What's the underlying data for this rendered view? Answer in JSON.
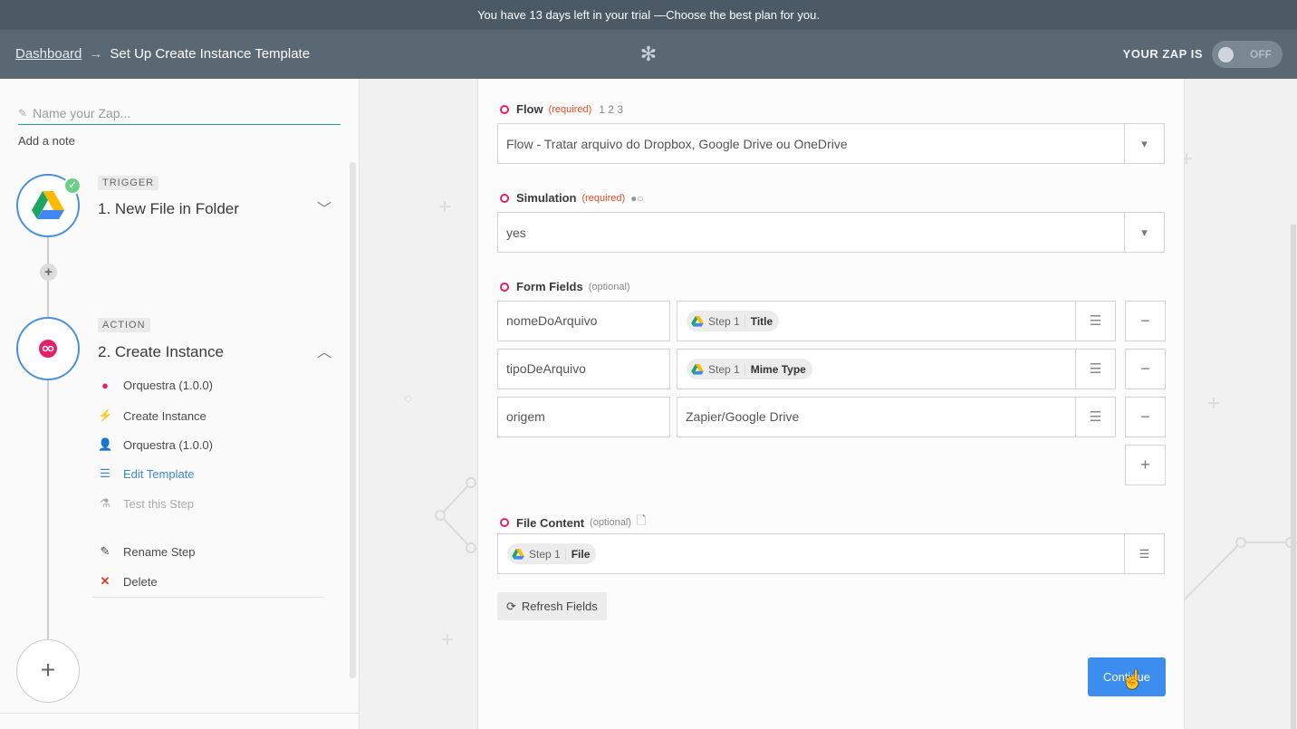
{
  "trial": {
    "lead": "You have 13 days left in your trial",
    "cta": "—Choose the best plan for you."
  },
  "header": {
    "dashboard": "Dashboard",
    "arrow": "→",
    "title": "Set Up Create Instance Template",
    "zap_label": "YOUR ZAP IS",
    "zap_state": "OFF"
  },
  "sidebar": {
    "name_placeholder": "Name your Zap...",
    "add_note": "Add a note",
    "trigger": {
      "badge": "TRIGGER",
      "title": "1. New File in Folder"
    },
    "action": {
      "badge": "ACTION",
      "title": "2. Create Instance"
    },
    "substeps": [
      {
        "label": "Orquestra (1.0.0)",
        "icon": "orquestra-icon"
      },
      {
        "label": "Create Instance",
        "icon": "bolt-icon"
      },
      {
        "label": "Orquestra (1.0.0)",
        "icon": "user-icon"
      },
      {
        "label": "Edit Template",
        "icon": "list-icon"
      },
      {
        "label": "Test this Step",
        "icon": "flask-icon"
      }
    ],
    "rename": "Rename Step",
    "delete": "Delete"
  },
  "form": {
    "flow": {
      "label": "Flow",
      "required": "(required)",
      "extra": "1 2 3",
      "value": "Flow - Tratar arquivo do Dropbox, Google Drive ou OneDrive"
    },
    "simulation": {
      "label": "Simulation",
      "required": "(required)",
      "value": "yes"
    },
    "form_fields": {
      "label": "Form Fields",
      "optional": "(optional)",
      "rows": [
        {
          "key": "nomeDoArquivo",
          "step": "Step 1",
          "field": "Title"
        },
        {
          "key": "tipoDeArquivo",
          "step": "Step 1",
          "field": "Mime Type"
        },
        {
          "key": "origem",
          "text": "Zapier/Google Drive"
        }
      ]
    },
    "file_content": {
      "label": "File Content",
      "optional": "(optional)",
      "step": "Step 1",
      "field": "File"
    },
    "refresh": "Refresh Fields",
    "continue": "Continue"
  }
}
